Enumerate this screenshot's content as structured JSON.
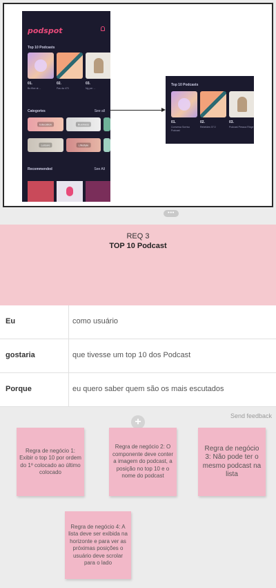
{
  "mockup": {
    "brand": "podspot",
    "top_title": "Top 10 Podcasts",
    "categories_title": "Categories",
    "see_all_1": "See all",
    "recommended_title": "Recommended",
    "see_all_2": "See All",
    "ranks": [
      "01.",
      "02.",
      "03."
    ],
    "subtitles": [
      "Bo ffice at ... ",
      "Pas da 470",
      "Ng per ..."
    ],
    "category_tags": [
      "Education",
      "Business",
      "Leisure",
      "Lifestyle"
    ],
    "mini_title": "Top 10 Podcasts",
    "mini_subs": [
      "Conversa Sorriso Podcast",
      "Rebeldes 07.0",
      "Podcast Pessoa Ringe"
    ],
    "colors": {
      "phone_bg": "#1b1a2e",
      "brand": "#e84a7a"
    }
  },
  "handle_icon": "more-horizontal-icon",
  "story": {
    "req_label": "REQ 3",
    "title": "TOP 10 Podcast",
    "rows": [
      {
        "key": "Eu",
        "value": "como usuário"
      },
      {
        "key": "gostaria",
        "value": "que tivesse um top 10 dos Podcast"
      },
      {
        "key": "Porque",
        "value": "eu quero saber quem são os mais escutados"
      }
    ],
    "header_color": "#f5c9cf"
  },
  "send_feedback": "Send feedback",
  "add_icon": "plus-icon",
  "notes": [
    "Regra de negócio 1: Exibir o top 10 por ordem do 1º colocado ao último colocado",
    "Regra de negócio 2: O componente deve conter a imagem do podcast, a posição no top 10 e o nome do podcast",
    "Regra de negócio 3: Não pode ter o mesmo podcast na lista",
    "Regra de negócio 4: A lista deve ser exibida na horizonte e para ver as próximas posições o usuário deve scrolar para o lado"
  ],
  "note_color": "#f2b8c8"
}
